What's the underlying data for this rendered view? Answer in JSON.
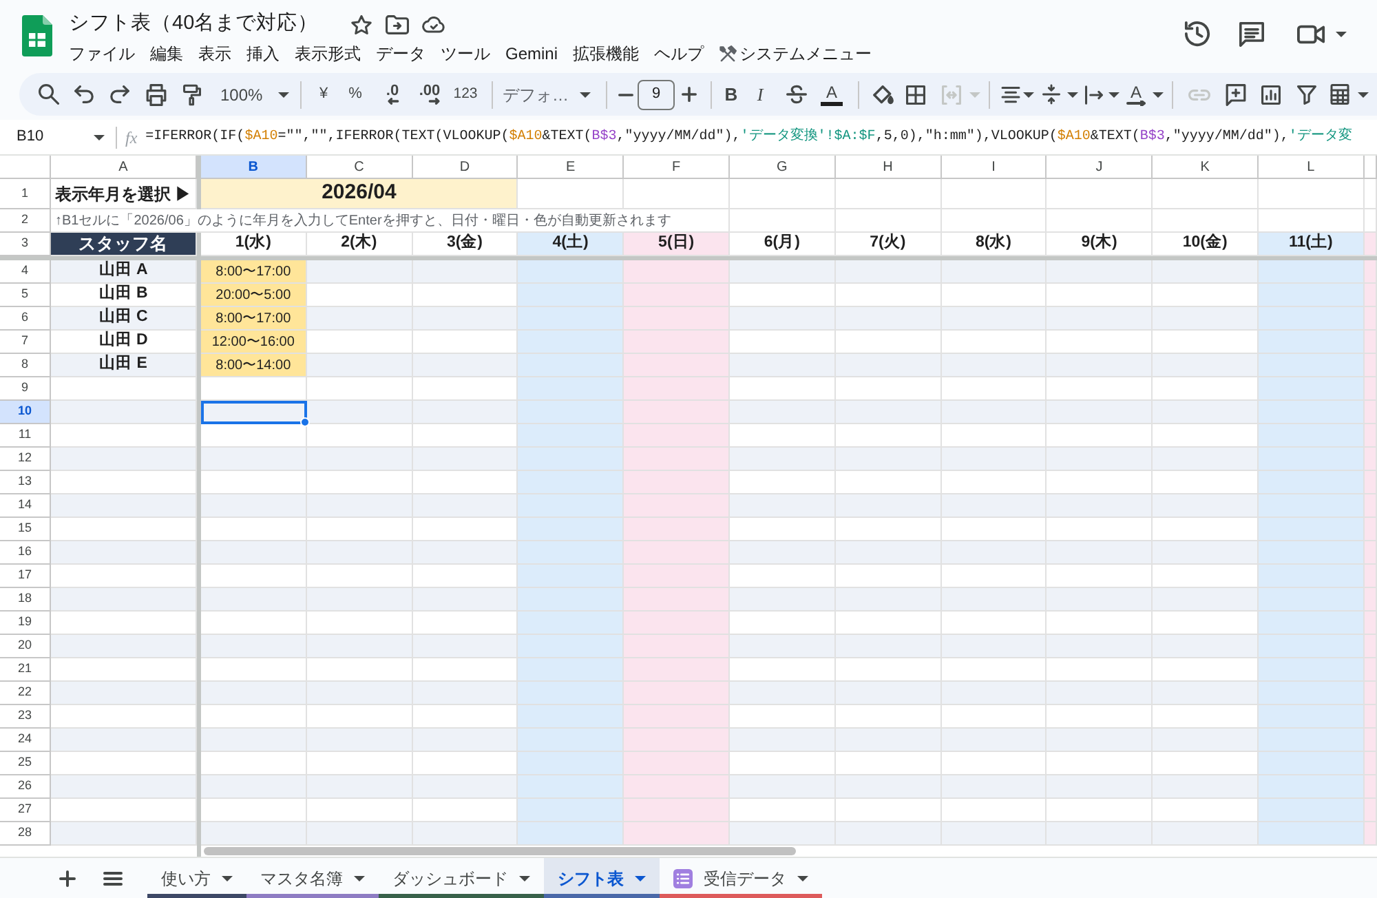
{
  "document": {
    "title": "シフト表（40名まで対応）"
  },
  "menu": [
    {
      "label": "ファイル",
      "kind": "plain"
    },
    {
      "label": "編集",
      "kind": "plain"
    },
    {
      "label": "表示",
      "kind": "plain"
    },
    {
      "label": "挿入",
      "kind": "plain"
    },
    {
      "label": "表示形式",
      "kind": "plain"
    },
    {
      "label": "データ",
      "kind": "plain"
    },
    {
      "label": "ツール",
      "kind": "plain"
    },
    {
      "label": "Gemini",
      "kind": "plain"
    },
    {
      "label": "拡張機能",
      "kind": "plain"
    },
    {
      "label": "ヘルプ",
      "kind": "plain"
    },
    {
      "label": "システムメニュー",
      "kind": "tools"
    }
  ],
  "toolbar": {
    "zoom": "100%",
    "currency": "¥",
    "percent": "%",
    "decrease_decimal": ".0",
    "increase_decimal": ".00",
    "number_format": "123",
    "font": "デフォ…",
    "font_size": "9",
    "bold": "B",
    "italic": "I",
    "text_color": "A",
    "text_rotation": "A",
    "merge_disabled": true,
    "link_disabled": true
  },
  "formula_bar": {
    "cell": "B10",
    "fx": "fx",
    "tokens": [
      {
        "text": "=IFERROR(IF("
      },
      {
        "text": "$A10",
        "color": "#d27e00"
      },
      {
        "text": "=\"\",\"\",IFERROR(TEXT(VLOOKUP("
      },
      {
        "text": "$A10",
        "color": "#d27e00"
      },
      {
        "text": "&TEXT("
      },
      {
        "text": "B$3",
        "color": "#9543c8"
      },
      {
        "text": ",\"yyyy/MM/dd\"),"
      },
      {
        "text": "'データ変換'!$A:$F",
        "color": "#12957f"
      },
      {
        "text": ",5,0),\"h:mm\"),VLOOKUP("
      },
      {
        "text": "$A10",
        "color": "#d27e00"
      },
      {
        "text": "&TEXT("
      },
      {
        "text": "B$3",
        "color": "#9543c8"
      },
      {
        "text": ",\"yyyy/MM/dd\"),"
      },
      {
        "text": "'データ変",
        "color": "#12957f"
      }
    ]
  },
  "sheet": {
    "columns": [
      {
        "label": "A",
        "selected": false
      },
      {
        "label": "B",
        "selected": true
      },
      {
        "label": "C",
        "selected": false
      },
      {
        "label": "D",
        "selected": false
      },
      {
        "label": "E",
        "selected": false
      },
      {
        "label": "F",
        "selected": false
      },
      {
        "label": "G",
        "selected": false
      },
      {
        "label": "H",
        "selected": false
      },
      {
        "label": "I",
        "selected": false
      },
      {
        "label": "J",
        "selected": false
      },
      {
        "label": "K",
        "selected": false
      },
      {
        "label": "L",
        "selected": false
      }
    ],
    "rows": [
      {
        "label": "1",
        "selected": false
      },
      {
        "label": "2",
        "selected": false
      },
      {
        "label": "3",
        "selected": false
      },
      {
        "label": "4",
        "selected": false
      },
      {
        "label": "5",
        "selected": false
      },
      {
        "label": "6",
        "selected": false
      },
      {
        "label": "7",
        "selected": false
      },
      {
        "label": "8",
        "selected": false
      },
      {
        "label": "9",
        "selected": false
      },
      {
        "label": "10",
        "selected": true
      },
      {
        "label": "11",
        "selected": false
      },
      {
        "label": "12",
        "selected": false
      },
      {
        "label": "13",
        "selected": false
      },
      {
        "label": "14",
        "selected": false
      },
      {
        "label": "15",
        "selected": false
      },
      {
        "label": "16",
        "selected": false
      },
      {
        "label": "17",
        "selected": false
      },
      {
        "label": "18",
        "selected": false
      },
      {
        "label": "19",
        "selected": false
      },
      {
        "label": "20",
        "selected": false
      },
      {
        "label": "21",
        "selected": false
      },
      {
        "label": "22",
        "selected": false
      },
      {
        "label": "23",
        "selected": false
      },
      {
        "label": "24",
        "selected": false
      },
      {
        "label": "25",
        "selected": false
      },
      {
        "label": "26",
        "selected": false
      },
      {
        "label": "27",
        "selected": false
      },
      {
        "label": "28",
        "selected": false
      }
    ],
    "month_prompt": "表示年月を選択 ▶",
    "month": "2026/04",
    "note": "↑B1セルに「2026/06」のように年月を入力してEnterを押すと、日付・曜日・色が自動更新されます",
    "staff_header": "スタッフ名",
    "days": [
      {
        "label": "1(水)",
        "kind": "weekday"
      },
      {
        "label": "2(木)",
        "kind": "weekday"
      },
      {
        "label": "3(金)",
        "kind": "weekday"
      },
      {
        "label": "4(土)",
        "kind": "saturday"
      },
      {
        "label": "5(日)",
        "kind": "sunday"
      },
      {
        "label": "6(月)",
        "kind": "weekday"
      },
      {
        "label": "7(火)",
        "kind": "weekday"
      },
      {
        "label": "8(水)",
        "kind": "weekday"
      },
      {
        "label": "9(木)",
        "kind": "weekday"
      },
      {
        "label": "10(金)",
        "kind": "weekday"
      },
      {
        "label": "11(土)",
        "kind": "saturday"
      },
      {
        "kind": "sunday"
      }
    ],
    "staff": [
      {
        "name": "山田 A",
        "shifts": [
          "8:00〜17:00"
        ]
      },
      {
        "name": "山田 B",
        "shifts": [
          "20:00〜5:00"
        ]
      },
      {
        "name": "山田 C",
        "shifts": [
          "8:00〜17:00"
        ]
      },
      {
        "name": "山田 D",
        "shifts": [
          "12:00〜16:00"
        ]
      },
      {
        "name": "山田 E",
        "shifts": [
          "8:00〜14:00"
        ]
      }
    ]
  },
  "sheet_tabs": [
    {
      "label": "使い方",
      "kind": "sheet",
      "selected": false,
      "color": "#3d4866"
    },
    {
      "label": "マスタ名簿",
      "kind": "sheet",
      "selected": false,
      "color": "#8e7cc3"
    },
    {
      "label": "ダッシュボード",
      "kind": "sheet",
      "selected": false,
      "color": "#38614a"
    },
    {
      "label": "シフト表",
      "kind": "sheet",
      "selected": true,
      "color": "#4a68a8"
    },
    {
      "label": "受信データ",
      "kind": "form",
      "selected": false,
      "color": "#dd5b5b"
    }
  ]
}
